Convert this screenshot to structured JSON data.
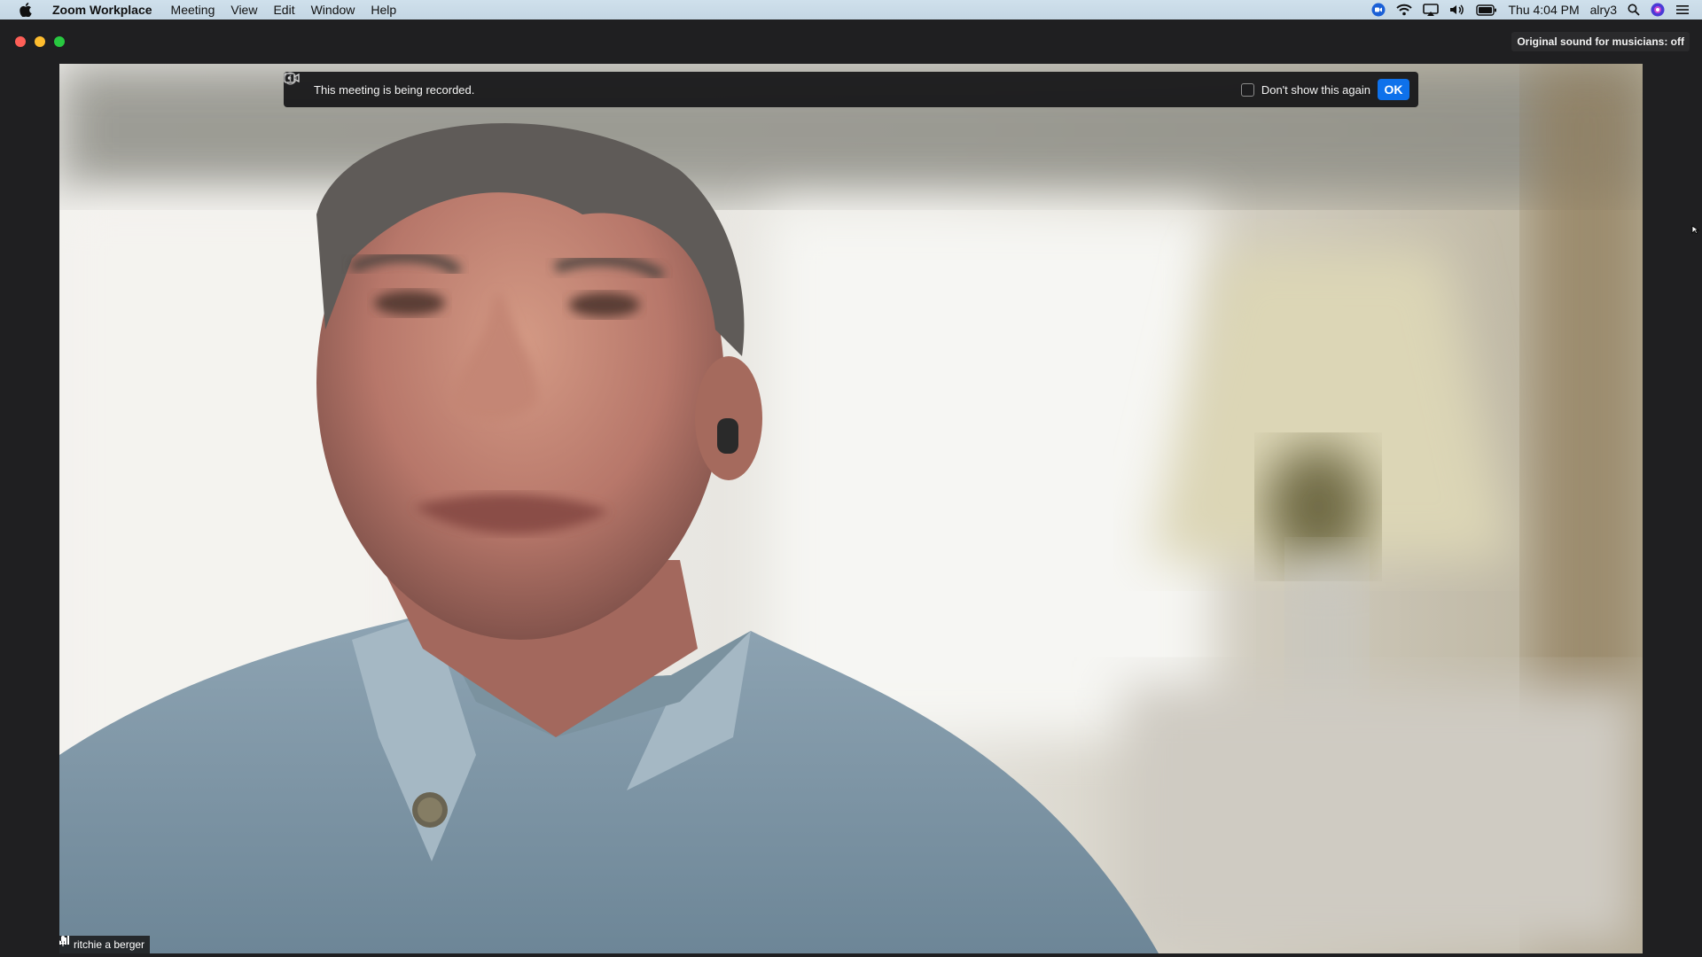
{
  "menubar": {
    "apple_icon": "apple-icon",
    "app_name": "Zoom Workplace",
    "items": [
      "Meeting",
      "View",
      "Edit",
      "Window",
      "Help"
    ],
    "status": {
      "clock": "Thu 4:04 PM",
      "user": "alry3",
      "icons": [
        "zoom-status-icon",
        "wifi-icon",
        "airplay-icon",
        "volume-icon",
        "battery-icon",
        "search-icon",
        "siri-icon",
        "control-center-icon"
      ]
    }
  },
  "window": {
    "original_sound_label": "Original sound for musicians: off"
  },
  "recording_banner": {
    "message": "This meeting is being recorded.",
    "checkbox_label": "Don't show this again",
    "checkbox_checked": false,
    "ok_label": "OK"
  },
  "participant": {
    "name": "ritchie a berger"
  },
  "colors": {
    "ok_button": "#0e71eb",
    "close": "#fe5f57",
    "minimize": "#febc2e",
    "maximize": "#28c840"
  }
}
